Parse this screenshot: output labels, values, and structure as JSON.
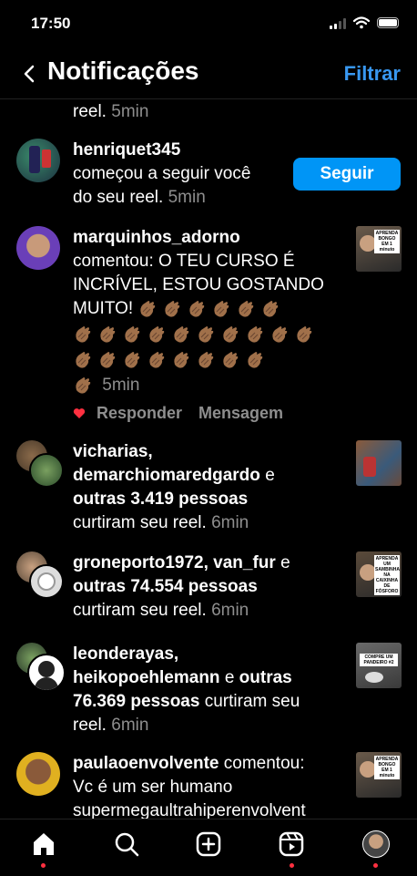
{
  "status_bar": {
    "time": "17:50"
  },
  "header": {
    "title": "Notificações",
    "filter_label": "Filtrar"
  },
  "notifications": [
    {
      "type": "partial",
      "text": "reel.",
      "time": "5min"
    },
    {
      "type": "follow",
      "username": "henriquet345",
      "text1": "começou a seguir você",
      "text2": "do seu reel.",
      "time": "5min",
      "button": "Seguir"
    },
    {
      "type": "comment",
      "username": "marquinhos_adorno",
      "line1": "comentou: O TEU CURSO É",
      "line2": "INCRÍVEL, ESTOU GOSTANDO",
      "line3": "MUITO!",
      "time": "5min",
      "thumb_caption": "APRENDA BONGO EM 1 minuto",
      "actions": {
        "reply": "Responder",
        "message": "Mensagem"
      }
    },
    {
      "type": "likes",
      "user1": "vicharias,",
      "user2": "demarchiomaredgardo",
      "conj": "e",
      "others": "outras 3.419 pessoas",
      "text": "curtiram seu reel.",
      "time": "6min"
    },
    {
      "type": "likes",
      "user1": "groneporto1972,",
      "user2": "van_fur",
      "conj": "e",
      "others": "outras 74.554 pessoas",
      "text": "curtiram seu reel.",
      "time": "6min",
      "thumb_caption": "APRENDA UM SAMBINHA NA CAIXINHA DE FÓSFORO"
    },
    {
      "type": "likes",
      "user1": "leonderayas,",
      "user2": "heikopoehlemann",
      "conj": "e",
      "others": "outras",
      "others2": "76.369 pessoas",
      "text": "curtiram seu",
      "text2": "reel.",
      "time": "6min",
      "thumb_caption": "COMPRE UM PANDEIRO #2"
    },
    {
      "type": "comment2",
      "username": "paulaoenvolvente",
      "text1": "comentou:",
      "line2": "Vc é um ser humano",
      "line3": "supermegaultrahiperenvolvent",
      "thumb_caption": "APRENDA BONGO EM 1 minuto"
    }
  ],
  "colors": {
    "accent": "#0095f6",
    "link": "#3897f0",
    "muted": "#8e8e8e",
    "heart": "#ff3040"
  }
}
